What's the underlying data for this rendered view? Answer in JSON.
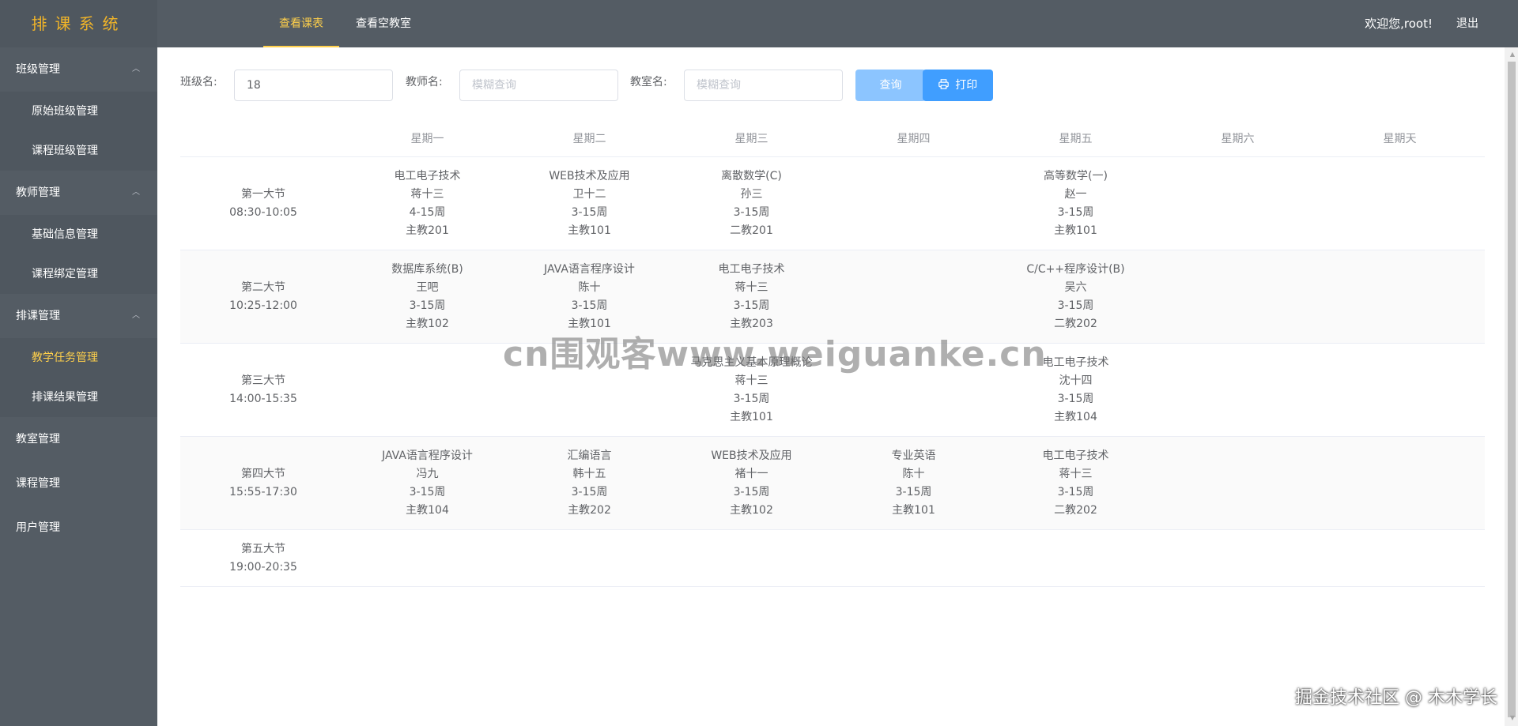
{
  "header": {
    "brand": "排课系统",
    "tabs": [
      {
        "label": "查看课表",
        "active": true
      },
      {
        "label": "查看空教室",
        "active": false
      }
    ],
    "welcome": "欢迎您,root!",
    "logout": "退出"
  },
  "sidebar": {
    "groups": [
      {
        "label": "班级管理",
        "expanded": true,
        "items": [
          "原始班级管理",
          "课程班级管理"
        ]
      },
      {
        "label": "教师管理",
        "expanded": true,
        "items": [
          "基础信息管理",
          "课程绑定管理"
        ]
      },
      {
        "label": "排课管理",
        "expanded": true,
        "items": [
          "教学任务管理",
          "排课结果管理"
        ],
        "active_item": "教学任务管理"
      },
      {
        "label": "教室管理",
        "expanded": false,
        "items": []
      },
      {
        "label": "课程管理",
        "expanded": false,
        "items": []
      },
      {
        "label": "用户管理",
        "expanded": false,
        "items": []
      }
    ]
  },
  "filters": {
    "class_label": "班级名:",
    "class_value": "18",
    "teacher_label": "教师名:",
    "teacher_placeholder": "模糊查询",
    "room_label": "教室名:",
    "room_placeholder": "模糊查询",
    "query_button": "查询",
    "print_button": "打印"
  },
  "timetable": {
    "days": [
      "星期一",
      "星期二",
      "星期三",
      "星期四",
      "星期五",
      "星期六",
      "星期天"
    ],
    "periods": [
      {
        "name": "第一大节",
        "time": "08:30-10:05"
      },
      {
        "name": "第二大节",
        "time": "10:25-12:00"
      },
      {
        "name": "第三大节",
        "time": "14:00-15:35"
      },
      {
        "name": "第四大节",
        "time": "15:55-17:30"
      },
      {
        "name": "第五大节",
        "time": "19:00-20:35"
      }
    ],
    "rows": [
      [
        {
          "course": "电工电子技术",
          "teacher": "蒋十三",
          "weeks": "4-15周",
          "room": "主教201"
        },
        {
          "course": "WEB技术及应用",
          "teacher": "卫十二",
          "weeks": "3-15周",
          "room": "主教101"
        },
        {
          "course": "离散数学(C)",
          "teacher": "孙三",
          "weeks": "3-15周",
          "room": "二教201"
        },
        null,
        {
          "course": "高等数学(一)",
          "teacher": "赵一",
          "weeks": "3-15周",
          "room": "主教101"
        },
        null,
        null
      ],
      [
        {
          "course": "数据库系统(B)",
          "teacher": "王吧",
          "weeks": "3-15周",
          "room": "主教102"
        },
        {
          "course": "JAVA语言程序设计",
          "teacher": "陈十",
          "weeks": "3-15周",
          "room": "主教101"
        },
        {
          "course": "电工电子技术",
          "teacher": "蒋十三",
          "weeks": "3-15周",
          "room": "主教203"
        },
        null,
        {
          "course": "C/C++程序设计(B)",
          "teacher": "吴六",
          "weeks": "3-15周",
          "room": "二教202"
        },
        null,
        null
      ],
      [
        null,
        null,
        {
          "course": "马克思主义基本原理概论",
          "teacher": "蒋十三",
          "weeks": "3-15周",
          "room": "主教101"
        },
        null,
        {
          "course": "电工电子技术",
          "teacher": "沈十四",
          "weeks": "3-15周",
          "room": "主教104"
        },
        null,
        null
      ],
      [
        {
          "course": "JAVA语言程序设计",
          "teacher": "冯九",
          "weeks": "3-15周",
          "room": "主教104"
        },
        {
          "course": "汇编语言",
          "teacher": "韩十五",
          "weeks": "3-15周",
          "room": "主教202"
        },
        {
          "course": "WEB技术及应用",
          "teacher": "褚十一",
          "weeks": "3-15周",
          "room": "主教102"
        },
        {
          "course": "专业英语",
          "teacher": "陈十",
          "weeks": "3-15周",
          "room": "主教101"
        },
        {
          "course": "电工电子技术",
          "teacher": "蒋十三",
          "weeks": "3-15周",
          "room": "二教202"
        },
        null,
        null
      ],
      [
        null,
        null,
        null,
        null,
        null,
        null,
        null
      ]
    ]
  },
  "watermark": "cn围观客www.weiguanke.cn",
  "corner_mark": "掘金技术社区 @ 木木学长",
  "icons": {
    "print": "printer-icon",
    "chevron": "chevron-up-icon"
  },
  "colors": {
    "header_bg": "#545c64",
    "active": "#ffd04b",
    "primary": "#409eff"
  }
}
